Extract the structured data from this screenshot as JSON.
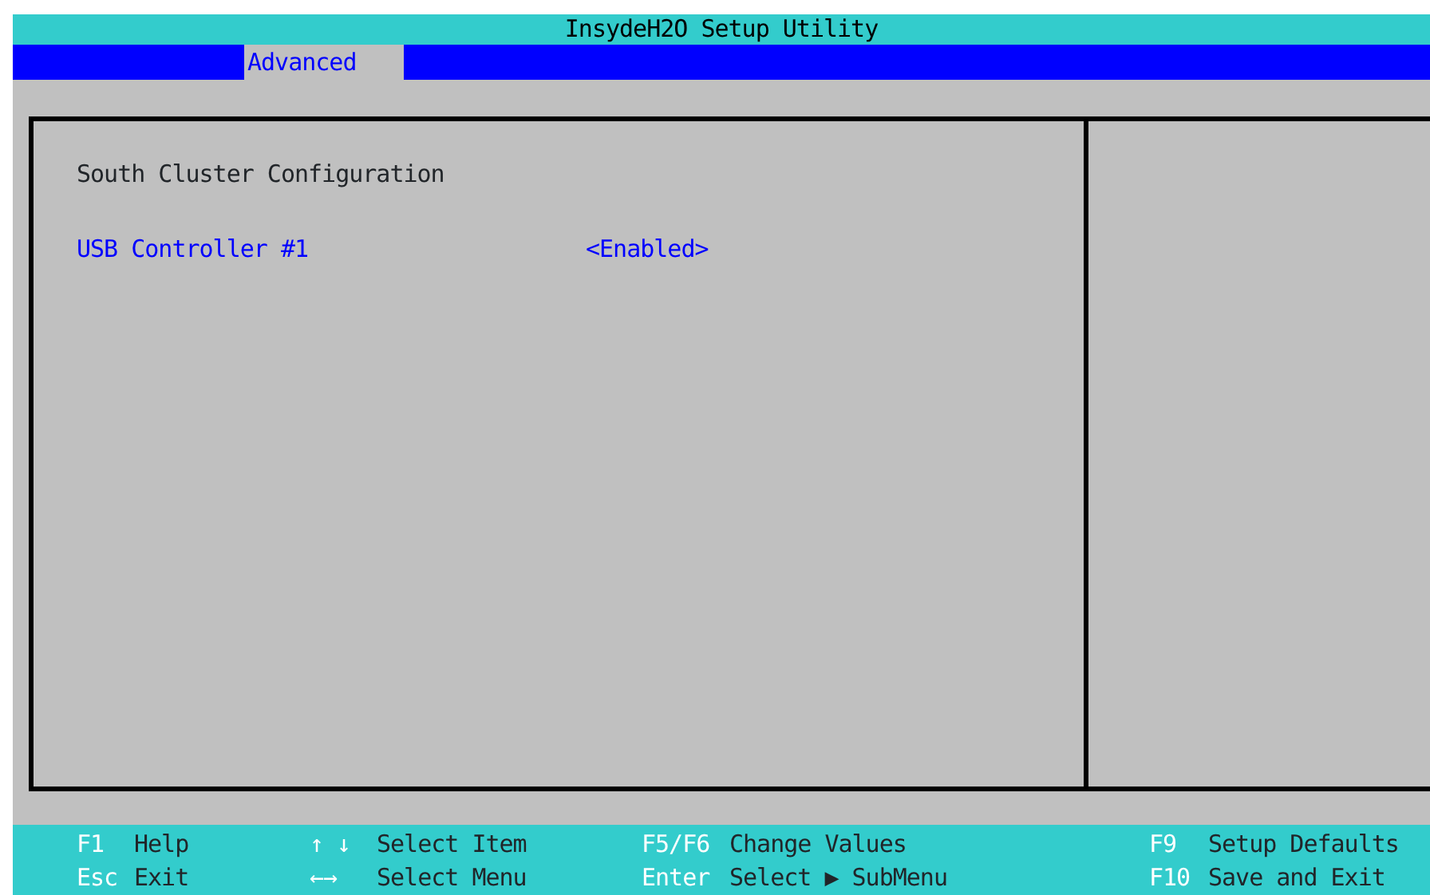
{
  "window": {
    "title": "InsydeH2O Setup Utility"
  },
  "tabs": [
    {
      "label": "Advanced",
      "selected": true
    }
  ],
  "main": {
    "heading": "South Cluster Configuration",
    "items": [
      {
        "label": "USB Controller #1",
        "value": "<Enabled>"
      }
    ]
  },
  "footer": [
    [
      {
        "key": "F1",
        "action": "Help"
      },
      {
        "key": "Esc",
        "action": "Exit"
      }
    ],
    [
      {
        "key": "↑ ↓",
        "action": "Select Item"
      },
      {
        "key": "←→",
        "action": "Select Menu"
      }
    ],
    [
      {
        "key": "F5/F6",
        "action": "Change Values"
      },
      {
        "key": "Enter",
        "action": "Select ▶ SubMenu"
      }
    ],
    [
      {
        "key": "F9",
        "action": "Setup Defaults"
      },
      {
        "key": "F10",
        "action": "Save and Exit"
      }
    ]
  ]
}
